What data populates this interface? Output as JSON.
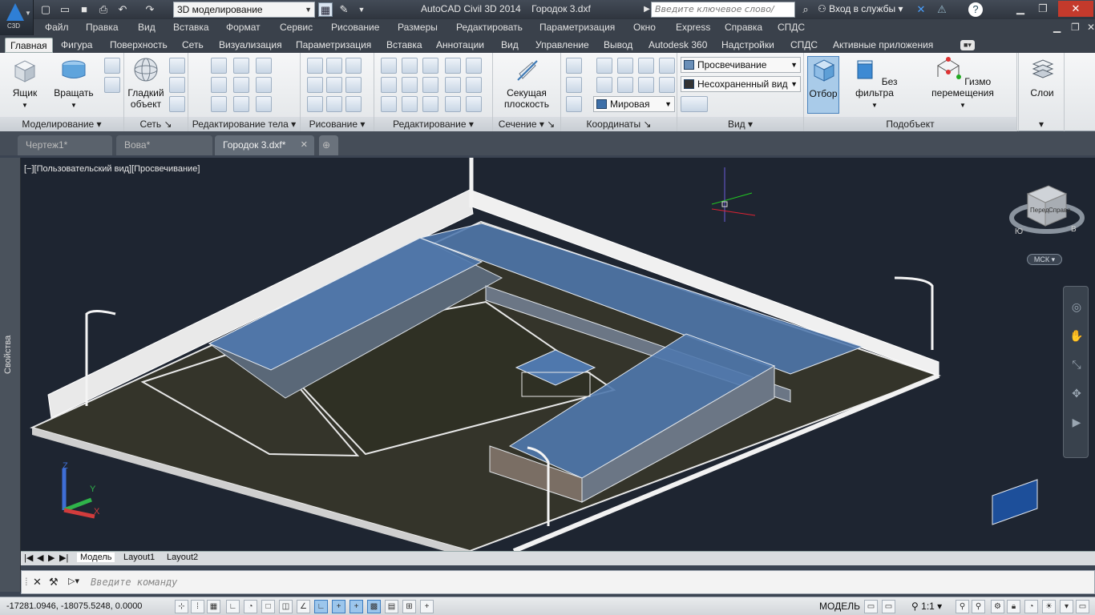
{
  "app": {
    "title": "AutoCAD Civil 3D 2014",
    "file": "Городок 3.dxf",
    "logo_label": "C3D",
    "workspace": "3D моделирование",
    "search_placeholder": "Введите ключевое слово/фразу",
    "signin": "Вход в службы"
  },
  "menubar": [
    "Файл",
    "Правка",
    "Вид",
    "Вставка",
    "Формат",
    "Сервис",
    "Рисование",
    "Размеры",
    "Редактировать",
    "Параметризация",
    "Окно",
    "Express",
    "Справка",
    "СПДС"
  ],
  "ribbon_tabs": [
    "Главная",
    "Фигура",
    "Поверхность",
    "Сеть",
    "Визуализация",
    "Параметризация",
    "Вставка",
    "Аннотации",
    "Вид",
    "Управление",
    "Вывод",
    "Autodesk 360",
    "Надстройки",
    "СПДС",
    "Активные приложения"
  ],
  "active_ribbon_tab": "Главная",
  "panels": {
    "modeling": {
      "title": "Моделирование",
      "box": "Ящик",
      "extrude": "Вращать"
    },
    "mesh": {
      "title": "Сеть",
      "smooth_line1": "Гладкий",
      "smooth_line2": "объект"
    },
    "solid_edit": {
      "title": "Редактирование тела"
    },
    "draw": {
      "title": "Рисование"
    },
    "modify": {
      "title": "Редактирование"
    },
    "section": {
      "title": "Сечение",
      "plane_line1": "Секущая",
      "plane_line2": "плоскость"
    },
    "coords": {
      "title": "Координаты",
      "ucs_select": "Мировая"
    },
    "view": {
      "title": "Вид",
      "visual_style": "Просвечивание",
      "saved_view": "Несохраненный вид"
    },
    "subobject": {
      "title": "Подобъект",
      "culling": "Отбор",
      "no_filter": "Без фильтра",
      "gizmo": "Гизмо перемещения"
    },
    "layers": {
      "title": "Слои"
    }
  },
  "doc_tabs": [
    {
      "label": "Чертеж1*",
      "active": false
    },
    {
      "label": "Вова*",
      "active": false
    },
    {
      "label": "Городок 3.dxf*",
      "active": true
    }
  ],
  "viewport": {
    "label": "[−][Пользовательский вид][Просвечивание]",
    "viewcube_front": "Перед",
    "viewcube_right": "Справа",
    "compass_s": "Ю",
    "compass_w": "В",
    "ucs_label": "МСК",
    "axis_x": "X",
    "axis_y": "Y",
    "axis_z": "Z"
  },
  "properties_palette": "Свойства",
  "layout_tabs": [
    "Модель",
    "Layout1",
    "Layout2"
  ],
  "command_prompt": "Введите команду",
  "status": {
    "coords": "-17281.0946, -18075.5248, 0.0000",
    "space": "МОДЕЛЬ",
    "scale": "1:1"
  },
  "colors": {
    "accent": "#2f7fd6",
    "viewport_bg": "#1e2531",
    "roof": "#4a6a95",
    "ground": "#34342a"
  }
}
